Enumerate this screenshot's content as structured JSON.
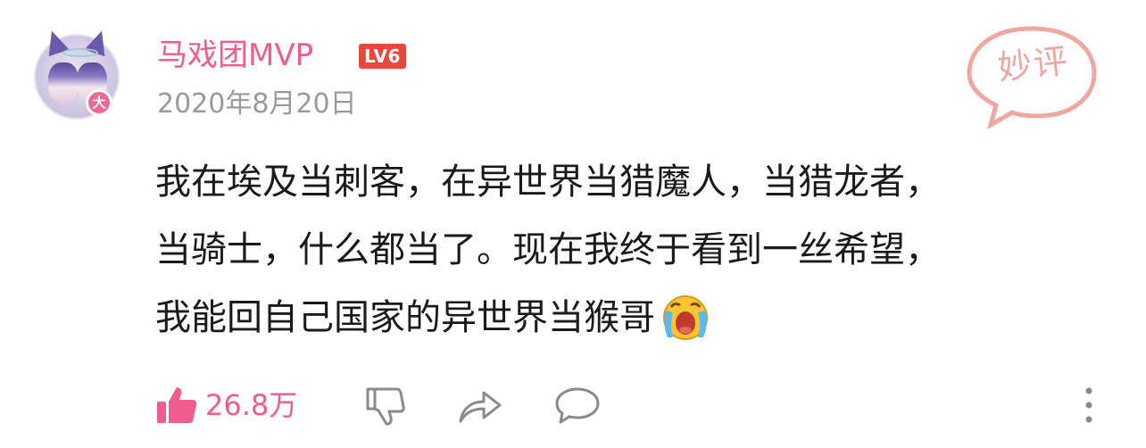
{
  "comment": {
    "username": "马戏团MVP",
    "level": "LV6",
    "avatar_badge": "大",
    "date": "2020年8月20日",
    "stamp": "妙评",
    "text_lines": [
      "我在埃及当刺客，在异世界当猎魔人，当猎龙者，",
      "当骑士，什么都当了。现在我终于看到一丝希望，",
      "我能回自己国家的异世界当猴哥"
    ],
    "emoji": "crying-face-emoji"
  },
  "actions": {
    "like_count": "26.8万",
    "icons": [
      "thumbs-up-icon",
      "thumbs-down-icon",
      "share-icon",
      "reply-icon",
      "more-icon"
    ]
  },
  "colors": {
    "accent_pink": "#f05b90",
    "level_red": "#e8483c",
    "stamp_pink": "#f0a7a0",
    "muted_gray": "#9a9a9a",
    "icon_gray": "#8a8a8a"
  }
}
